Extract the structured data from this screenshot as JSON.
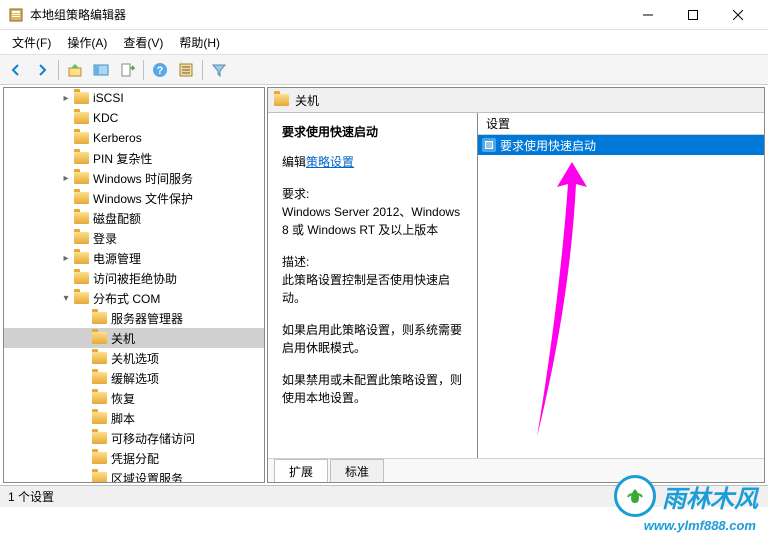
{
  "window": {
    "title": "本地组策略编辑器"
  },
  "menu": {
    "file": "文件(F)",
    "action": "操作(A)",
    "view": "查看(V)",
    "help": "帮助(H)"
  },
  "tree": {
    "items": [
      {
        "label": "iSCSI",
        "indent": 3,
        "toggle": ">"
      },
      {
        "label": "KDC",
        "indent": 3,
        "toggle": ""
      },
      {
        "label": "Kerberos",
        "indent": 3,
        "toggle": ""
      },
      {
        "label": "PIN 复杂性",
        "indent": 3,
        "toggle": ""
      },
      {
        "label": "Windows 时间服务",
        "indent": 3,
        "toggle": ">"
      },
      {
        "label": "Windows 文件保护",
        "indent": 3,
        "toggle": ""
      },
      {
        "label": "磁盘配额",
        "indent": 3,
        "toggle": ""
      },
      {
        "label": "登录",
        "indent": 3,
        "toggle": ""
      },
      {
        "label": "电源管理",
        "indent": 3,
        "toggle": ">"
      },
      {
        "label": "访问被拒绝协助",
        "indent": 3,
        "toggle": ""
      },
      {
        "label": "分布式 COM",
        "indent": 3,
        "toggle": "v"
      },
      {
        "label": "服务器管理器",
        "indent": 4,
        "toggle": ""
      },
      {
        "label": "关机",
        "indent": 4,
        "toggle": "",
        "selected": true
      },
      {
        "label": "关机选项",
        "indent": 4,
        "toggle": ""
      },
      {
        "label": "缓解选项",
        "indent": 4,
        "toggle": ""
      },
      {
        "label": "恢复",
        "indent": 4,
        "toggle": ""
      },
      {
        "label": "脚本",
        "indent": 4,
        "toggle": ""
      },
      {
        "label": "可移动存储访问",
        "indent": 4,
        "toggle": ""
      },
      {
        "label": "凭据分配",
        "indent": 4,
        "toggle": ""
      },
      {
        "label": "区域设置服务",
        "indent": 4,
        "toggle": ""
      }
    ]
  },
  "content": {
    "header": "关机",
    "detail": {
      "title": "要求使用快速启动",
      "edit_label": "编辑",
      "edit_link": "策略设置",
      "req_label": "要求:",
      "req_text": "Windows Server 2012、Windows 8 或 Windows RT 及以上版本",
      "desc_label": "描述:",
      "desc_text1": "此策略设置控制是否使用快速启动。",
      "desc_text2": "如果启用此策略设置，则系统需要启用休眠模式。",
      "desc_text3": "如果禁用或未配置此策略设置，则使用本地设置。"
    },
    "list": {
      "column": "设置",
      "item": "要求使用快速启动"
    },
    "tabs": {
      "extended": "扩展",
      "standard": "标准"
    }
  },
  "statusbar": {
    "text": "1 个设置"
  },
  "watermark": {
    "brand": "雨林木风",
    "url": "www.ylmf888.com"
  }
}
